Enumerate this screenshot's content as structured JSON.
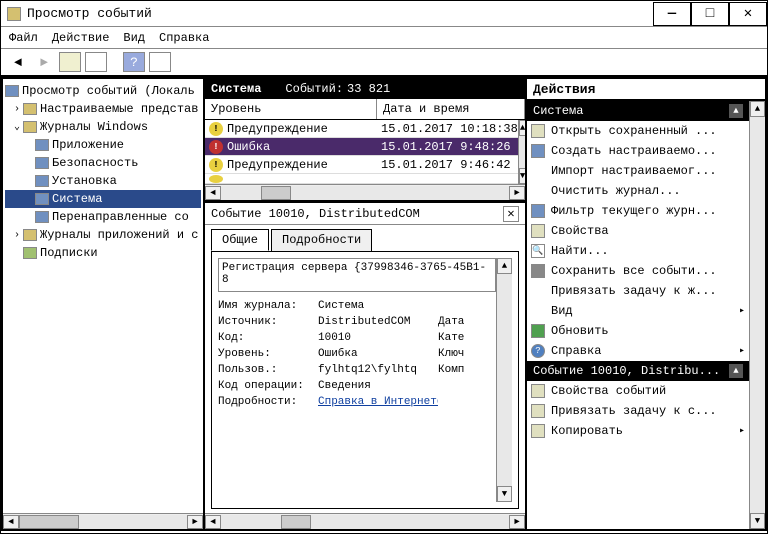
{
  "window": {
    "title": "Просмотр событий"
  },
  "menus": {
    "file": "Файл",
    "action": "Действие",
    "view": "Вид",
    "help": "Справка"
  },
  "tree": {
    "root": "Просмотр событий (Локаль",
    "custom": "Настраиваемые представ",
    "winlogs": "Журналы Windows",
    "app": "Приложение",
    "security": "Безопасность",
    "setup": "Установка",
    "system": "Система",
    "forwarded": "Перенаправленные со",
    "appsvc": "Журналы приложений и с",
    "subs": "Подписки"
  },
  "list": {
    "title": "Система",
    "count_label": "Событий:",
    "count": "33 821",
    "col_level": "Уровень",
    "col_date": "Дата и время",
    "rows": [
      {
        "icon": "warn",
        "level": "Предупреждение",
        "date": "15.01.2017 10:18:38"
      },
      {
        "icon": "err",
        "level": "Ошибка",
        "date": "15.01.2017 9:48:26"
      },
      {
        "icon": "warn",
        "level": "Предупреждение",
        "date": "15.01.2017 9:46:42"
      }
    ]
  },
  "detail": {
    "title": "Событие 10010, DistributedCOM",
    "tab_general": "Общие",
    "tab_details": "Подробности",
    "desc": "Регистрация сервера {37998346-3765-45B1-8",
    "fields": {
      "logname_k": "Имя журнала:",
      "logname_v": "Система",
      "source_k": "Источник:",
      "source_v": "DistributedCOM",
      "source_r": "Дата",
      "code_k": "Код:",
      "code_v": "10010",
      "code_r": "Кате",
      "level_k": "Уровень:",
      "level_v": "Ошибка",
      "level_r": "Ключ",
      "user_k": "Пользов.:",
      "user_v": "fylhtq12\\fylhtq",
      "user_r": "Комп",
      "opcode_k": "Код операции:",
      "opcode_v": "Сведения",
      "more_k": "Подробности:",
      "more_v": "Справка в Интернете"
    }
  },
  "actions": {
    "header": "Действия",
    "section1": "Система",
    "items1": {
      "open_saved": "Открыть сохраненный ...",
      "create_custom": "Создать настраиваемо...",
      "import_custom": "Импорт настраиваемог...",
      "clear_log": "Очистить журнал...",
      "filter": "Фильтр текущего журн...",
      "props": "Свойства",
      "find": "Найти...",
      "save_all": "Сохранить все событи...",
      "attach_task": "Привязать задачу к ж...",
      "view": "Вид",
      "refresh": "Обновить",
      "help": "Справка"
    },
    "section2": "Событие 10010, Distribu...",
    "items2": {
      "event_props": "Свойства событий",
      "attach_task2": "Привязать задачу к с...",
      "copy": "Копировать"
    }
  }
}
